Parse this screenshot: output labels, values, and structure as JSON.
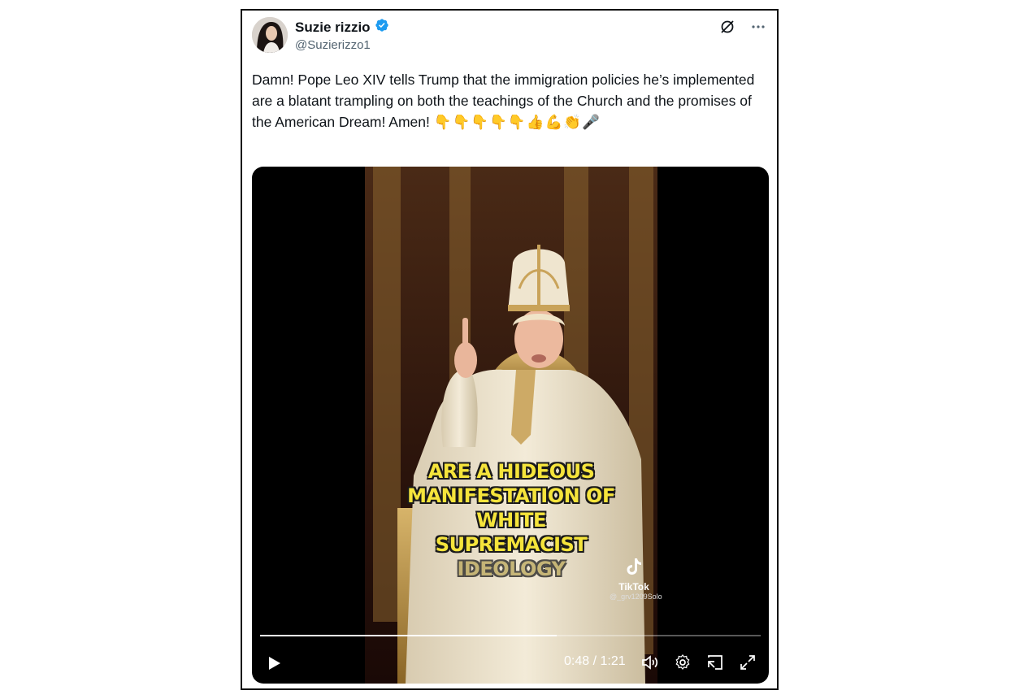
{
  "author": {
    "display_name": "Suzie rizzio",
    "handle": "@Suzierizzo1",
    "verified": true
  },
  "header_icons": [
    "grok-icon",
    "more-icon"
  ],
  "tweet": {
    "text": "Damn!  Pope Leo XIV tells Trump that the immigration policies he’s implemented are a blatant trampling on both the teachings of the Church and the promises of the American Dream! Amen!",
    "emojis": "👇👇👇👇👇👍💪👏🎤"
  },
  "video": {
    "caption_lines": [
      "ARE A HIDEOUS",
      "MANIFESTATION OF",
      "WHITE",
      "SUPREMACIST",
      "IDEOLOGY"
    ],
    "watermark_brand": "TikTok",
    "watermark_user": "@_grv1209Solo",
    "time_display": "0:48 / 1:21",
    "progress": 0.593,
    "controls": [
      "play-icon",
      "volume-icon",
      "settings-icon",
      "pip-icon",
      "fullscreen-icon"
    ]
  },
  "colors": {
    "verified_blue": "#1d9bf0",
    "caption_yellow": "#f5e43b",
    "handle_gray": "#536471"
  }
}
